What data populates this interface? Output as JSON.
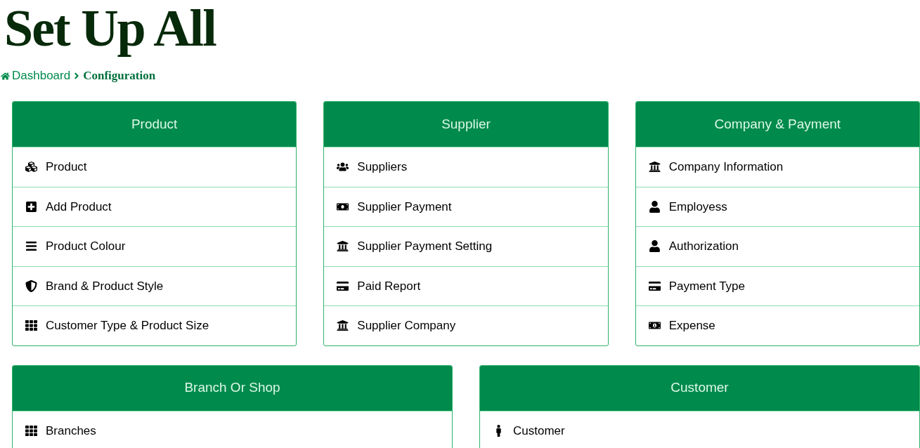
{
  "page_title": "Set Up All",
  "breadcrumb": {
    "items": [
      {
        "label": "Dashboard",
        "current": false
      },
      {
        "label": "Configuration",
        "current": true
      }
    ]
  },
  "panels": [
    {
      "title": "Product",
      "items": [
        "Product",
        "Add Product",
        "Product Colour",
        "Brand & Product Style",
        "Customer Type & Product Size"
      ]
    },
    {
      "title": "Supplier",
      "items": [
        "Suppliers",
        "Supplier Payment",
        "Supplier Payment Setting",
        "Paid Report",
        "Supplier Company"
      ]
    },
    {
      "title": "Company & Payment",
      "items": [
        "Company Information",
        "Employess",
        "Authorization",
        "Payment Type",
        "Expense"
      ]
    },
    {
      "title": "Branch Or Shop",
      "items": [
        "Branches"
      ]
    },
    {
      "title": "Customer",
      "items": [
        "Customer"
      ]
    }
  ]
}
